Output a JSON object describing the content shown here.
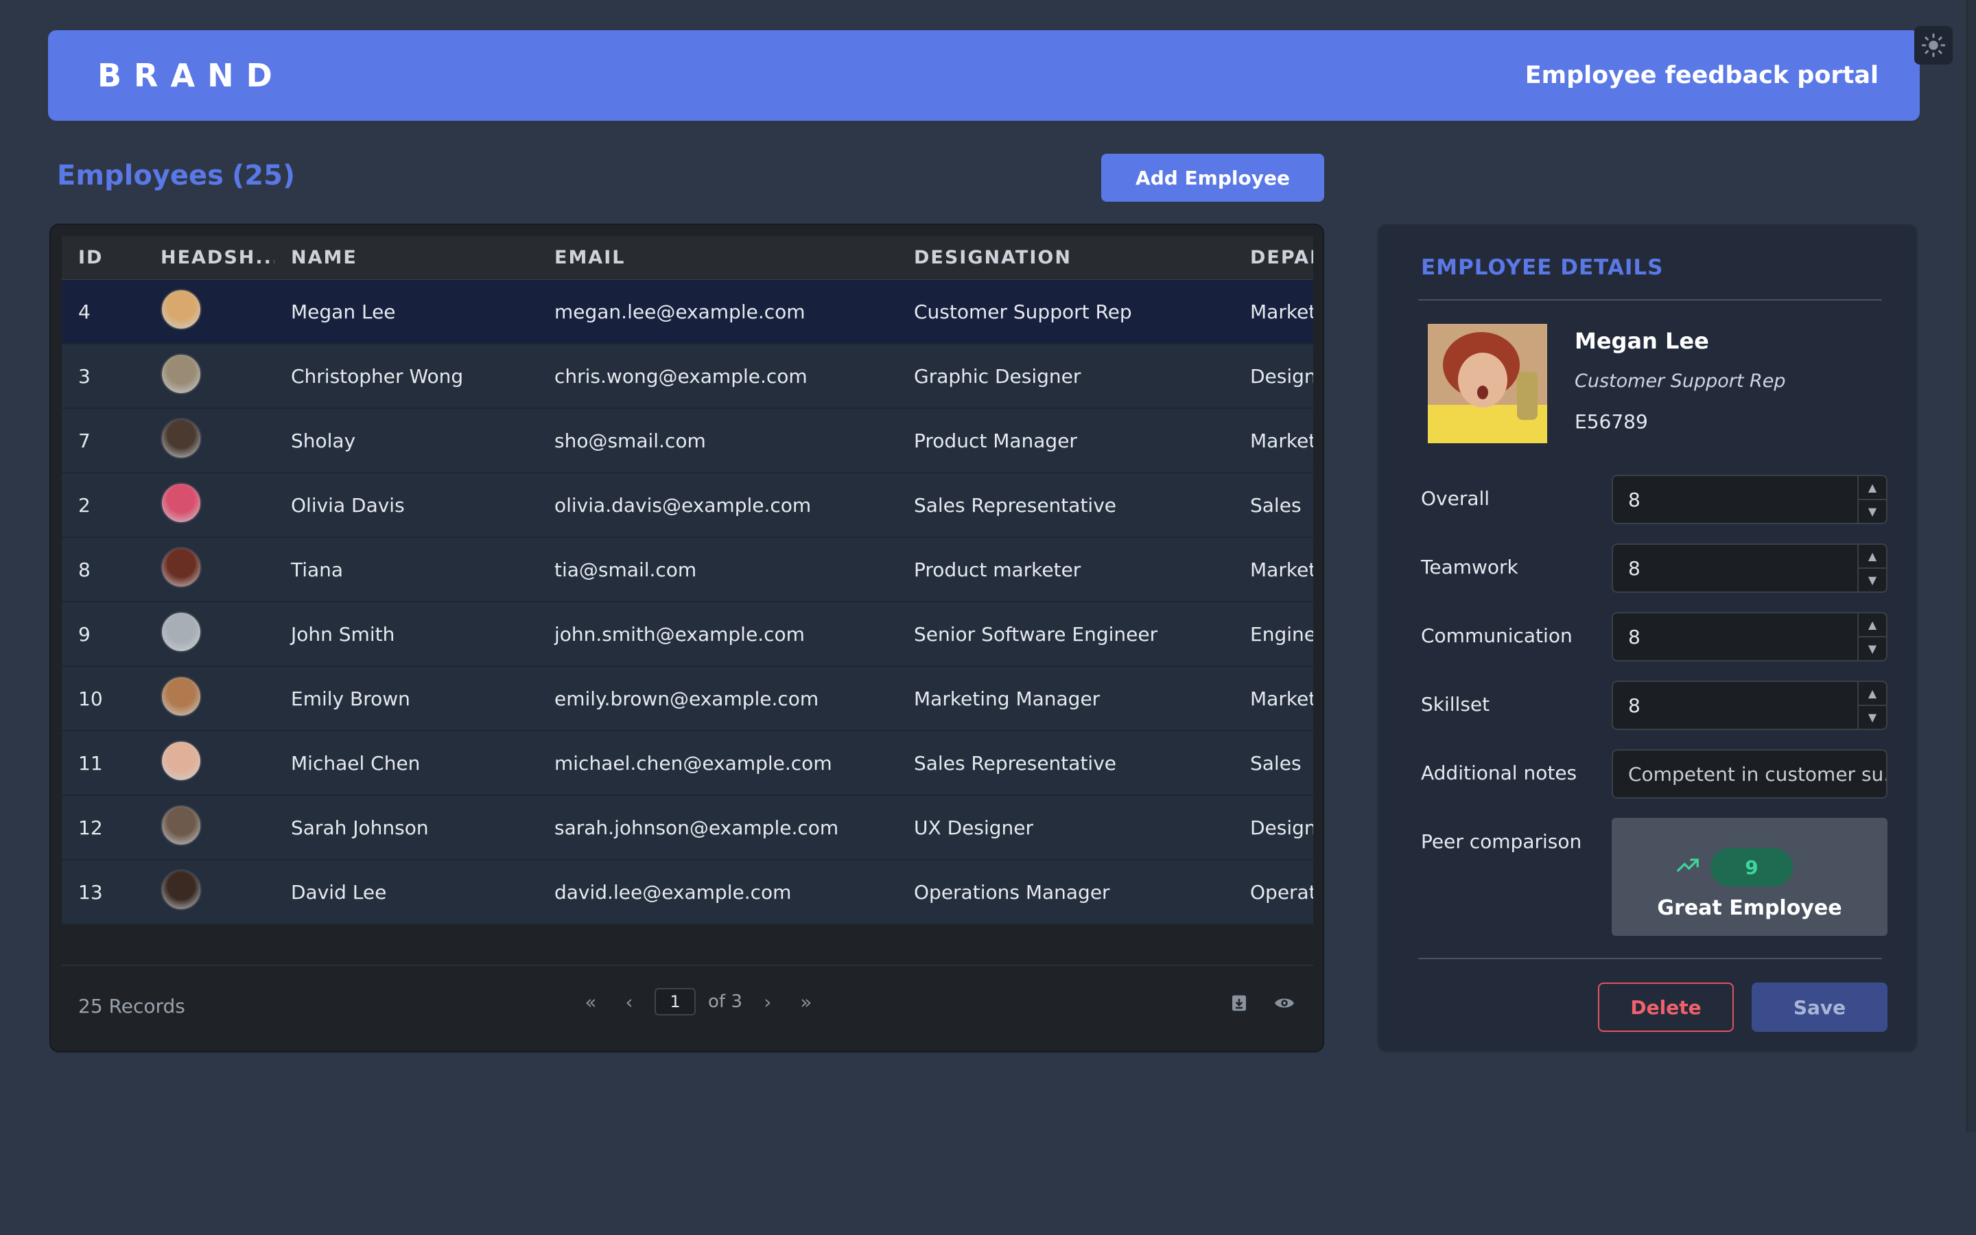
{
  "header": {
    "brand": "BRAND",
    "portal_title": "Employee feedback portal",
    "theme_icon": "sun-icon"
  },
  "employees": {
    "title_label": "Employees",
    "count": "(25)",
    "add_button": "Add Employee"
  },
  "table": {
    "columns": [
      "ID",
      "HEADSH...",
      "NAME",
      "EMAIL",
      "DESIGNATION",
      "DEPAR"
    ],
    "rows": [
      {
        "id": "4",
        "name": "Megan Lee",
        "email": "megan.lee@example.com",
        "designation": "Customer Support Rep",
        "department": "Marketi",
        "avatar_color": "#d9a86c",
        "selected": true
      },
      {
        "id": "3",
        "name": "Christopher Wong",
        "email": "chris.wong@example.com",
        "designation": "Graphic Designer",
        "department": "Designi",
        "avatar_color": "#9a8c74"
      },
      {
        "id": "7",
        "name": "Sholay",
        "email": "sho@smail.com",
        "designation": "Product Manager",
        "department": "Marketi",
        "avatar_color": "#4a3a30"
      },
      {
        "id": "2",
        "name": "Olivia Davis",
        "email": "olivia.davis@example.com",
        "designation": "Sales Representative",
        "department": "Sales",
        "avatar_color": "#d8506e"
      },
      {
        "id": "8",
        "name": "Tiana",
        "email": "tia@smail.com",
        "designation": "Product marketer",
        "department": "Marketi",
        "avatar_color": "#6a2e22"
      },
      {
        "id": "9",
        "name": "John Smith",
        "email": "john.smith@example.com",
        "designation": "Senior Software Engineer",
        "department": "Enginee",
        "avatar_color": "#a8aeb6"
      },
      {
        "id": "10",
        "name": "Emily Brown",
        "email": "emily.brown@example.com",
        "designation": "Marketing Manager",
        "department": "Marketi",
        "avatar_color": "#b07a4e"
      },
      {
        "id": "11",
        "name": "Michael Chen",
        "email": "michael.chen@example.com",
        "designation": "Sales Representative",
        "department": "Sales",
        "avatar_color": "#e0b098"
      },
      {
        "id": "12",
        "name": "Sarah Johnson",
        "email": "sarah.johnson@example.com",
        "designation": "UX Designer",
        "department": "Designi",
        "avatar_color": "#6e5a4c"
      },
      {
        "id": "13",
        "name": "David Lee",
        "email": "david.lee@example.com",
        "designation": "Operations Manager",
        "department": "Operati",
        "avatar_color": "#3a2a22"
      }
    ],
    "records_label": "25 Records",
    "pagination": {
      "first": "«",
      "prev": "‹",
      "current_page": "1",
      "of_label": "of 3",
      "next": "›",
      "last": "»"
    },
    "footer_icons": [
      "download-icon",
      "eye-icon"
    ]
  },
  "details": {
    "title": "EMPLOYEE DETAILS",
    "name": "Megan Lee",
    "designation": "Customer Support Rep",
    "employee_code": "E56789",
    "fields": [
      {
        "label": "Overall",
        "value": "8"
      },
      {
        "label": "Teamwork",
        "value": "8"
      },
      {
        "label": "Communication",
        "value": "8"
      },
      {
        "label": "Skillset",
        "value": "8"
      }
    ],
    "notes_label": "Additional notes",
    "notes_value": "Competent in customer su...",
    "peer_label": "Peer comparison",
    "peer_score": "9",
    "peer_text": "Great Employee",
    "peer_icon": "trend-up-icon",
    "delete_button": "Delete",
    "save_button": "Save"
  },
  "colors": {
    "accent": "#5a78e6",
    "background": "#2d3748",
    "danger": "#e2535f",
    "success": "#3ed59c"
  }
}
